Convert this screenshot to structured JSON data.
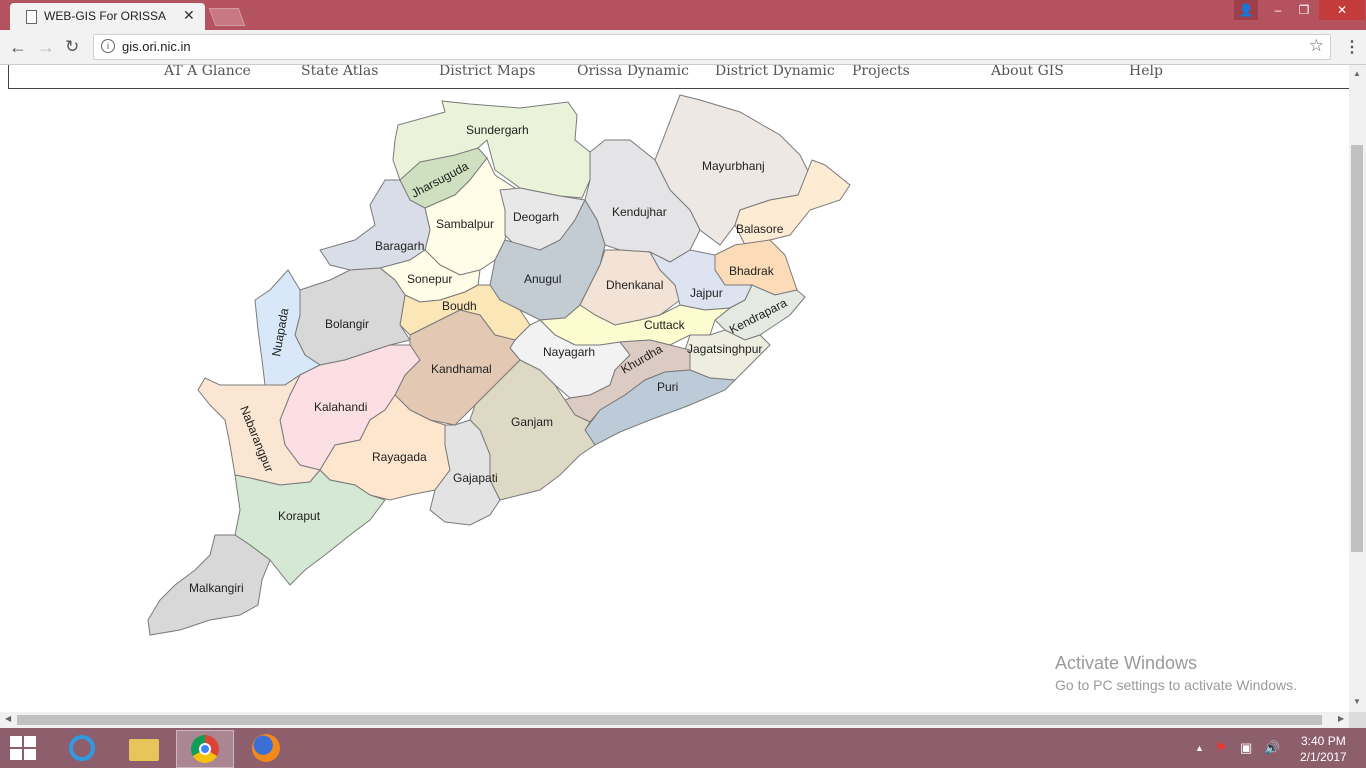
{
  "browser": {
    "tab_title": "WEB-GIS For ORISSA",
    "tab_close": "✕",
    "url": "gis.ori.nic.in",
    "window_controls": {
      "user": "👤",
      "minimize": "–",
      "maximize": "❐",
      "close": "✕"
    }
  },
  "site_nav": {
    "items": [
      "AT A Glance",
      "State Atlas",
      "District Maps",
      "Orissa Dynamic",
      "District Dynamic",
      "Projects",
      "About GIS",
      "Help"
    ]
  },
  "map": {
    "districts": {
      "sundergarh": "Sundergarh",
      "jharsuguda": "Jharsuguda",
      "mayurbhanj": "Mayurbhanj",
      "sambalpur": "Sambalpur",
      "deogarh": "Deogarh",
      "kendujhar": "Kendujhar",
      "baragarh": "Baragarh",
      "balasore": "Balasore",
      "sonepur": "Sonepur",
      "anugul": "Anugul",
      "bhadrak": "Bhadrak",
      "dhenkanal": "Dhenkanal",
      "boudh": "Boudh",
      "jajpur": "Jajpur",
      "bolangir": "Bolangir",
      "nuapada": "Nuapada",
      "kendrapara": "Kendrapara",
      "cuttack": "Cuttack",
      "nayagarh": "Nayagarh",
      "jagatsinghpur": "Jagatsinghpur",
      "khurdha": "Khurdha",
      "kandhamal": "Kandhamal",
      "puri": "Puri",
      "kalahandi": "Kalahandi",
      "nabarangpur": "Nabarangpur",
      "ganjam": "Ganjam",
      "rayagada": "Rayagada",
      "gajapati": "Gajapati",
      "koraput": "Koraput",
      "malkangiri": "Malkangiri"
    },
    "colors": {
      "sundergarh": "#eaf2d9",
      "jharsuguda": "#cfe0c0",
      "mayurbhanj": "#ede8e4",
      "sambalpur": "#fffde8",
      "deogarh": "#e8e8e8",
      "kendujhar": "#e4e4e6",
      "baragarh": "#d9dde8",
      "balasore": "#fdebd3",
      "sonepur": "#fffde8",
      "anugul": "#c3cbd3",
      "bhadrak": "#fcdcb8",
      "dhenkanal": "#f3e2d6",
      "boudh": "#fbe6b8",
      "jajpur": "#dde3f0",
      "bolangir": "#d8d8d8",
      "nuapada": "#d8e8f8",
      "kendrapara": "#e4e9e2",
      "cuttack": "#fdfbd0",
      "nayagarh": "#f2f2f2",
      "jagatsinghpur": "#eeeee0",
      "khurdha": "#dccbc3",
      "kandhamal": "#e3c9b4",
      "puri": "#bccbd7",
      "kalahandi": "#fcdfe2",
      "nabarangpur": "#fbe6d3",
      "ganjam": "#ddd9c5",
      "rayagada": "#fde6cd",
      "gajapati": "#e3e3e3",
      "koraput": "#d5e8d3",
      "malkangiri": "#d8d8d8"
    }
  },
  "watermark": {
    "title": "Activate Windows",
    "subtitle": "Go to PC settings to activate Windows."
  },
  "taskbar": {
    "time": "3:40 PM",
    "date": "2/1/2017",
    "apps": [
      "internet-explorer",
      "file-explorer",
      "chrome",
      "firefox"
    ]
  }
}
